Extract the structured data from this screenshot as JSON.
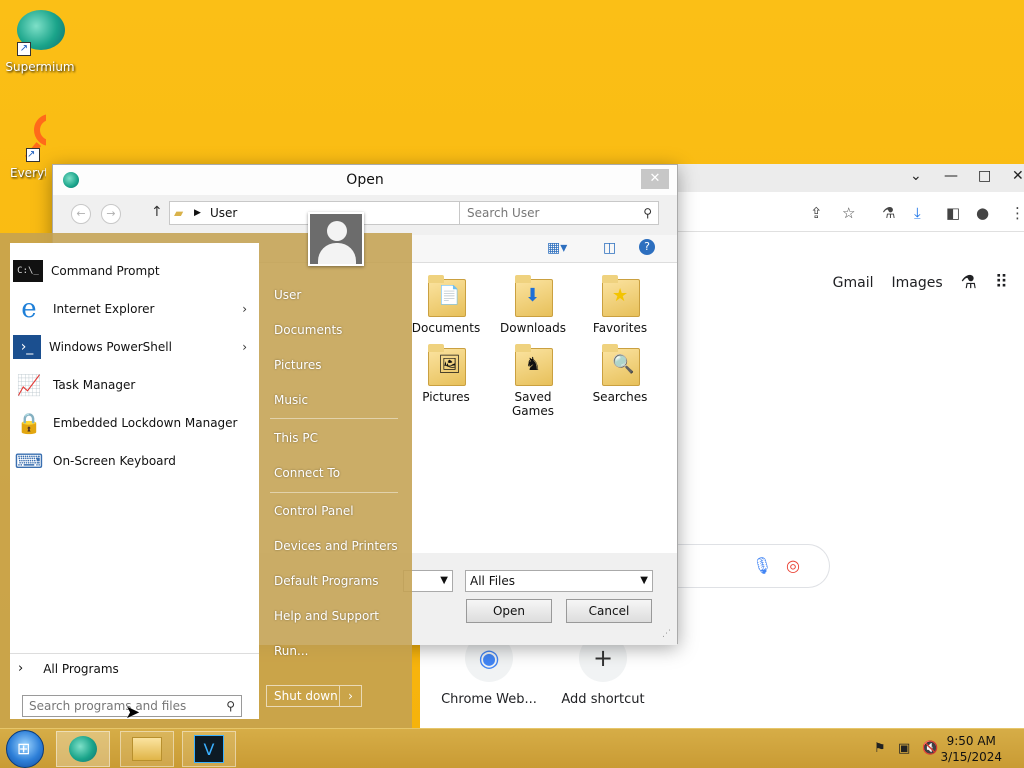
{
  "desktop": {
    "icons": [
      {
        "label": "Supermium"
      },
      {
        "label": "Everyt"
      }
    ]
  },
  "browser": {
    "links": {
      "gmail": "Gmail",
      "images": "Images"
    },
    "shortcuts": [
      {
        "label": "Chrome Web..."
      },
      {
        "label": "Add shortcut"
      }
    ]
  },
  "dialog": {
    "title": "Open",
    "address": "User",
    "search_placeholder": "Search User",
    "folders_right": [
      {
        "label": "Documents",
        "icon": "document-folder-icon"
      },
      {
        "label": "Downloads",
        "icon": "downloads-folder-icon"
      },
      {
        "label": "Favorites",
        "icon": "favorites-folder-icon"
      },
      {
        "label": "Pictures",
        "icon": "pictures-folder-icon"
      },
      {
        "label": "Saved Games",
        "icon": "saved-games-folder-icon"
      },
      {
        "label": "Searches",
        "icon": "searches-folder-icon"
      }
    ],
    "file_type": "All Files",
    "open_label": "Open",
    "cancel_label": "Cancel"
  },
  "start_menu": {
    "programs": [
      {
        "label": "Command Prompt",
        "icon": "cmd-icon",
        "submenu": false
      },
      {
        "label": "Internet Explorer",
        "icon": "ie-icon",
        "submenu": true
      },
      {
        "label": "Windows PowerShell",
        "icon": "powershell-icon",
        "submenu": true
      },
      {
        "label": "Task Manager",
        "icon": "task-manager-icon",
        "submenu": false
      },
      {
        "label": "Embedded Lockdown Manager",
        "icon": "lock-icon",
        "submenu": false
      },
      {
        "label": "On-Screen Keyboard",
        "icon": "keyboard-icon",
        "submenu": false
      }
    ],
    "all_programs": "All Programs",
    "search_placeholder": "Search programs and files",
    "right_items": [
      "User",
      "Documents",
      "Pictures",
      "Music",
      "This PC",
      "Connect To",
      "Control Panel",
      "Devices and Printers",
      "Default Programs",
      "Help and Support",
      "Run..."
    ],
    "shutdown": "Shut down"
  },
  "taskbar": {
    "time": "9:50 AM",
    "date": "3/15/2024",
    "app_v": "V"
  }
}
